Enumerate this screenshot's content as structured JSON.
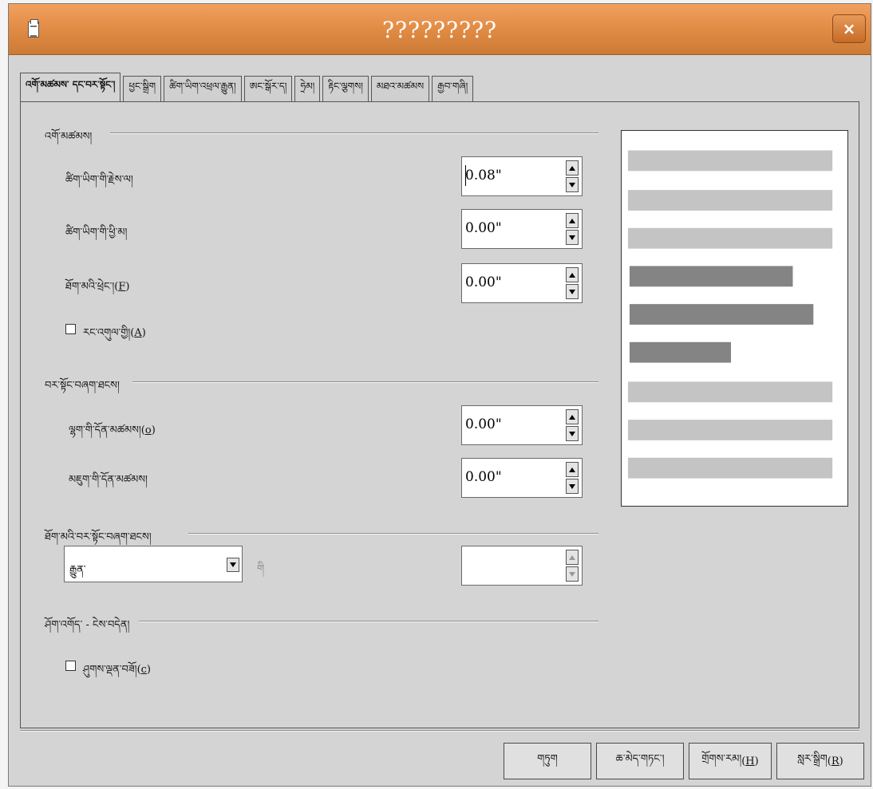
{
  "window": {
    "title": "?????????",
    "close_label": "×"
  },
  "tabs": [
    {
      "label": "འགོ་མཚམས་ དང་བར་སྟོང་།",
      "active": true
    },
    {
      "label": "ཕྱང་སྒྲིག",
      "active": false
    },
    {
      "label": "ཚིག་ཡིག་འཕྲལ་རྒྱུན།",
      "active": false
    },
    {
      "label": "ཨང་སྒོར་ད།",
      "active": false
    },
    {
      "label": "ཧྲེམ།",
      "active": false
    },
    {
      "label": "རྟིང་ལྕགས།",
      "active": false
    },
    {
      "label": "མཐའ་མཚམས",
      "active": false
    },
    {
      "label": "རྒྱབ་གཞི།",
      "active": false
    }
  ],
  "indent": {
    "heading": "འགོ་མཚམས།",
    "before_text": {
      "label": "ཚིག་ཡིག་གི་རྗེས་ལ།",
      "value": "0.08\""
    },
    "after_text": {
      "label": "ཚིག་ཡིག་གི་ཕྱི་མ།",
      "value": "0.00\""
    },
    "first_line": {
      "label": "ཐོག་མའི་ཕྲེང་།",
      "mnemonic": "F",
      "value": "0.00\""
    },
    "automatic": {
      "label": "རང་འགུལ་གྱི།",
      "mnemonic": "A",
      "checked": false
    }
  },
  "spacing": {
    "heading": "བར་སྟོང་བཞག་ཐངས།",
    "above": {
      "label": "ལྷག་གི་དོན་མཚམས།",
      "mnemonic": "o",
      "value": "0.00\""
    },
    "below": {
      "label": "མཇུག་གི་དོན་མཚམས།",
      "value": "0.00\""
    }
  },
  "line_spacing": {
    "heading": "ཐོག་མའི་བར་སྟོང་བཞག་ཐངས།",
    "selected": "རྒྱུན་",
    "of_label": "གི",
    "value": ""
  },
  "register": {
    "heading": "ཤོག་འགོད་ - ངེས་བདེན།",
    "activate": {
      "label": "ཤུགས་ལྡན་བཟོ།",
      "mnemonic": "c",
      "checked": false
    }
  },
  "buttons": {
    "ok": "གཏུག",
    "cancel": "ཆ་མེད་གཏང་།",
    "help": "གྲོགས་རམ།",
    "help_mnemonic": "H",
    "reset": "སླར་སྒྲིག",
    "reset_mnemonic": "R"
  },
  "preview": {
    "light_color": "#c4c4c4",
    "dark_color": "#848484"
  },
  "colors": {
    "titlebar": "#df8a43",
    "dialog_bg": "#d4d4d4"
  }
}
